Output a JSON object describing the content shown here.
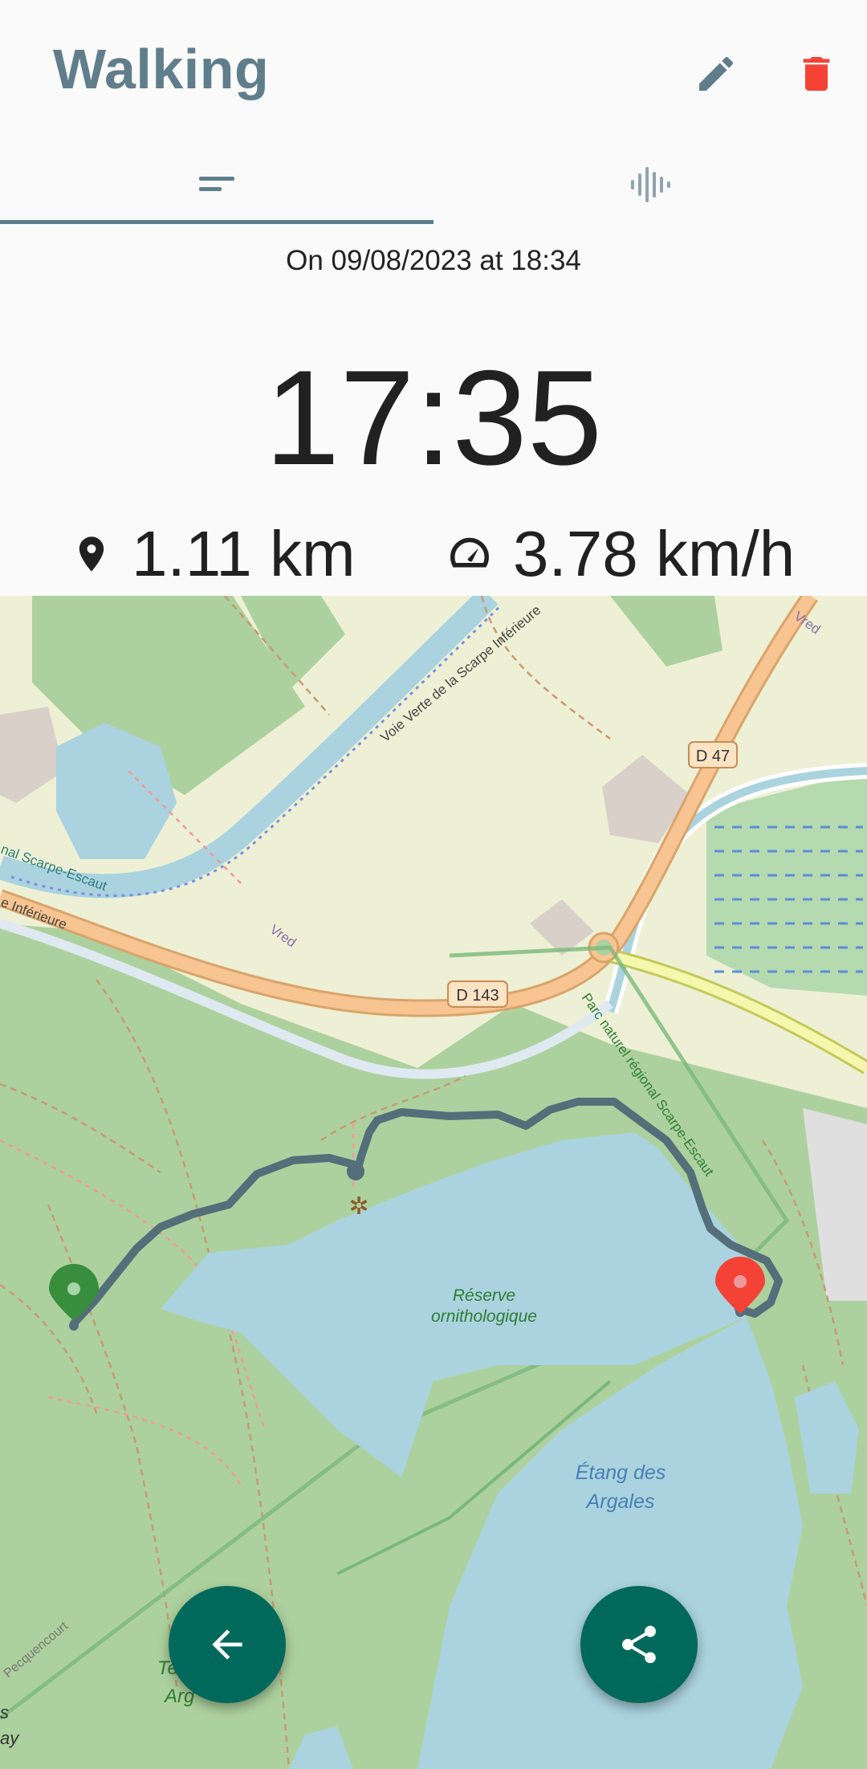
{
  "app": {
    "title": "Walking",
    "actions": [
      {
        "name": "edit",
        "icon": "pencil-icon",
        "color": "#607d8b"
      },
      {
        "name": "delete",
        "icon": "trash-icon",
        "color": "#f44336"
      }
    ]
  },
  "tabs": [
    {
      "name": "summary",
      "icon": "short-text-icon",
      "selected": true
    },
    {
      "name": "chart",
      "icon": "waveform-icon",
      "selected": false
    }
  ],
  "activity": {
    "date_text": "On 09/08/2023 at 18:34",
    "duration": "17:35",
    "distance": "1.11 km",
    "speed": "3.78 km/h"
  },
  "map": {
    "labels": {
      "canal1": "Voie Verte de la Scarpe Inférieure",
      "canal2": "nal Scarpe-Escaut",
      "canal3": "e Inférieure",
      "vred1": "Vred",
      "vred2": "Vred",
      "road1": "D 47",
      "road2": "D 143",
      "park": "Parc naturel régional Scarpe-Escaut",
      "reserve_line1": "Réserve",
      "reserve_line2": "ornithologique",
      "lake_line1": "Étang des",
      "lake_line2": "Argales",
      "street": "Pecquencourt",
      "partial1": "Te",
      "partial2": "Arg",
      "partial3": "s",
      "partial4": "ay"
    },
    "start_marker_color": "#388e3c",
    "end_marker_color": "#f44336",
    "track_color": "#546e7a"
  },
  "fabs": {
    "back": {
      "icon": "arrow-left-icon",
      "color": "#00695c"
    },
    "share": {
      "icon": "share-icon",
      "color": "#00695c"
    }
  }
}
